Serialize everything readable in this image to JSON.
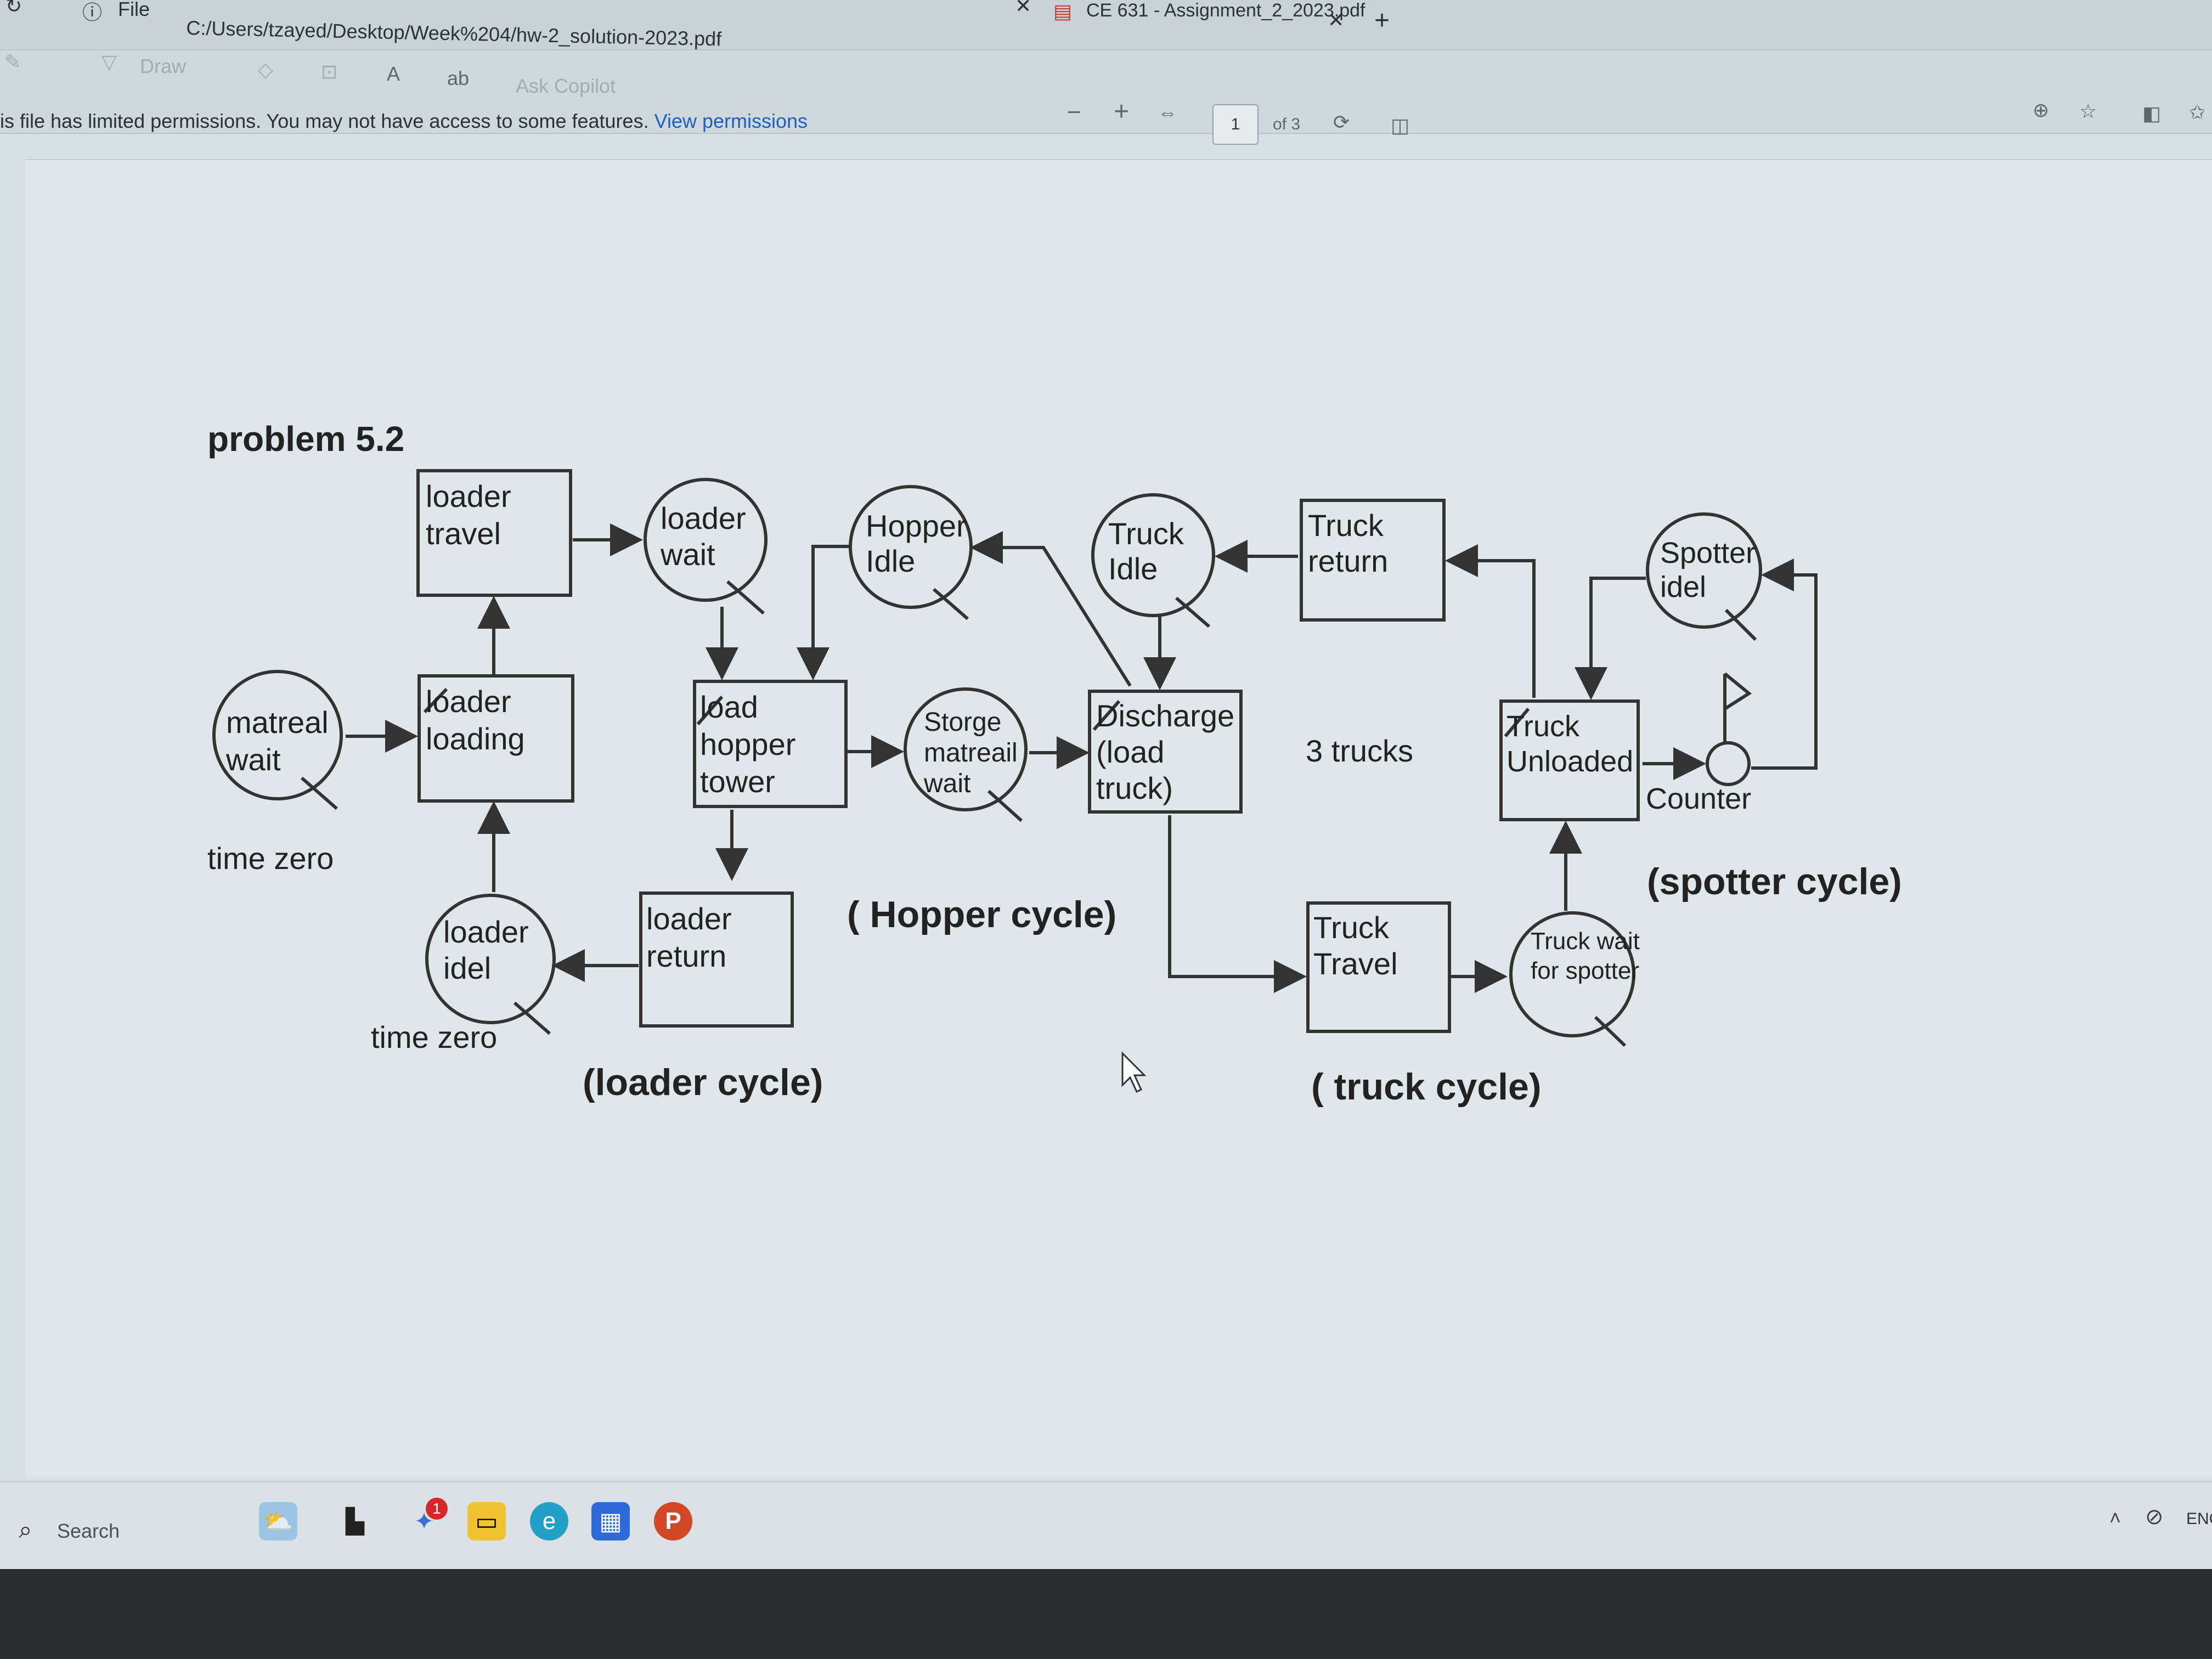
{
  "titlebar": {
    "file_label": "File",
    "file_path": "C:/Users/tzayed/Desktop/Week%204/hw-2_solution-2023.pdf",
    "tab_title": "CE 631 - Assignment_2_2023.pdf"
  },
  "toolbar": {
    "draw_label": "Draw",
    "ask_copilot": "Ask Copilot",
    "zoom_out": "−",
    "zoom_in": "+",
    "page_current": "1",
    "page_total": "of 3"
  },
  "permissions": {
    "message": "is file has limited permissions. You may not have access to some features.",
    "link": "View permissions"
  },
  "diagram": {
    "title": "problem 5.2",
    "nodes": {
      "loader_travel": [
        "loader",
        "travel"
      ],
      "loader_wait": [
        "loader",
        "wait"
      ],
      "hopper_idle": [
        "Hopper",
        "Idle"
      ],
      "truck_idle": [
        "Truck",
        "Idle"
      ],
      "truck_return": [
        "Truck",
        "return"
      ],
      "spotter_idel": [
        "Spotter",
        "idel"
      ],
      "matreal_wait": [
        "matreal",
        "wait"
      ],
      "loader_loading": [
        "loader",
        "loading"
      ],
      "load_hopper_tower": [
        "load",
        "hopper",
        "tower"
      ],
      "storge_matreail_wait": [
        "Storge",
        "matreail",
        "wait"
      ],
      "discharge": [
        "Discharge",
        "(load",
        "truck)"
      ],
      "truck_unloaded": [
        "Truck",
        "Unloaded"
      ],
      "counter": "Counter",
      "loader_idel": [
        "loader",
        "idel"
      ],
      "loader_return": [
        "loader",
        "return"
      ],
      "truck_travel": [
        "Truck",
        "Travel"
      ],
      "truck_wait_spotter": [
        "Truck wait",
        "for spotter"
      ]
    },
    "labels": {
      "time_zero_1": "time zero",
      "time_zero_2": "time zero",
      "three_trucks": "3 trucks",
      "hopper_cycle": "( Hopper cycle)",
      "loader_cycle": "(loader cycle)",
      "truck_cycle": "( truck cycle)",
      "spotter_cycle": "(spotter cycle)"
    }
  },
  "taskbar": {
    "search_label": "Search",
    "notification_count": "1",
    "tray_lang": "ENG"
  }
}
